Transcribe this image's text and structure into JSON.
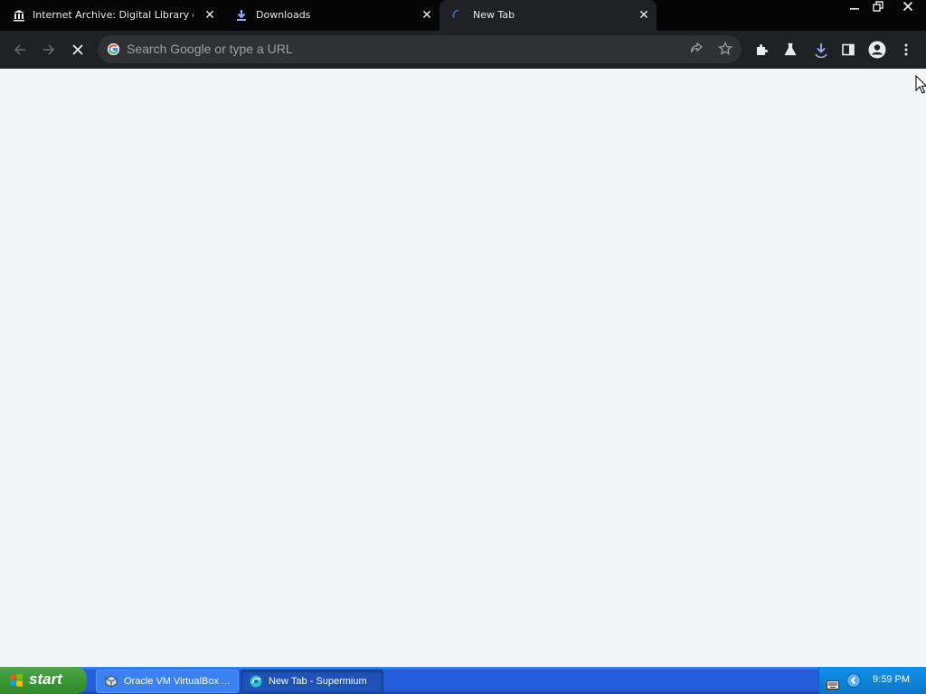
{
  "browser": {
    "tabs": [
      {
        "title": "Internet Archive: Digital Library of F",
        "icon": "institution-icon",
        "active": false
      },
      {
        "title": "Downloads",
        "icon": "download-icon",
        "active": false
      },
      {
        "title": "New Tab",
        "icon": "loading-spinner-icon",
        "active": true
      }
    ],
    "close_glyph": "✕",
    "window_controls": {
      "minimize": "—",
      "restore": "❐",
      "close": "✕"
    },
    "omnibox": {
      "placeholder": "Search Google or type a URL",
      "value": ""
    }
  },
  "taskbar": {
    "start_label": "start",
    "buttons": [
      {
        "label": "Oracle VM VirtualBox ...",
        "active": false
      },
      {
        "label": "New Tab - Supermium",
        "active": true
      }
    ],
    "clock": "9:59 PM"
  },
  "colors": {
    "tabstrip": "#050505",
    "toolbar": "#202124",
    "content": "#f4f5f7",
    "taskbar": "#245edb",
    "accent_blue": "#8ab4f8"
  }
}
